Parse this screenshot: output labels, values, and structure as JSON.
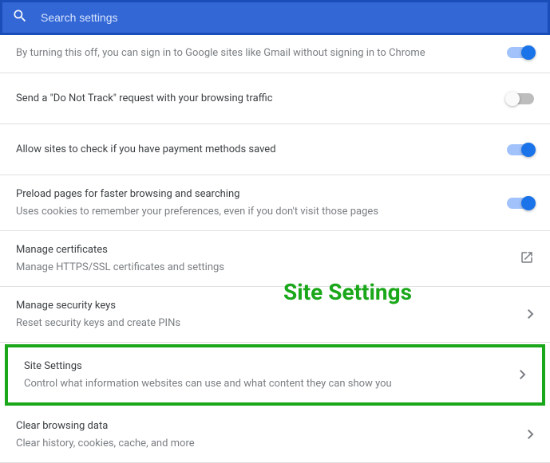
{
  "search": {
    "placeholder": "Search settings"
  },
  "rows": {
    "signin": {
      "sub": "By turning this off, you can sign in to Google sites like Gmail without signing in to Chrome"
    },
    "dnt": {
      "title": "Send a \"Do Not Track\" request with your browsing traffic"
    },
    "payment": {
      "title": "Allow sites to check if you have payment methods saved"
    },
    "preload": {
      "title": "Preload pages for faster browsing and searching",
      "sub": "Uses cookies to remember your preferences, even if you don't visit those pages"
    },
    "certs": {
      "title": "Manage certificates",
      "sub": "Manage HTTPS/SSL certificates and settings"
    },
    "keys": {
      "title": "Manage security keys",
      "sub": "Reset security keys and create PINs"
    },
    "site": {
      "title": "Site Settings",
      "sub": "Control what information websites can use and what content they can show you"
    },
    "clear": {
      "title": "Clear browsing data",
      "sub": "Clear history, cookies, cache, and more"
    }
  },
  "annotation": {
    "label": "Site Settings"
  }
}
